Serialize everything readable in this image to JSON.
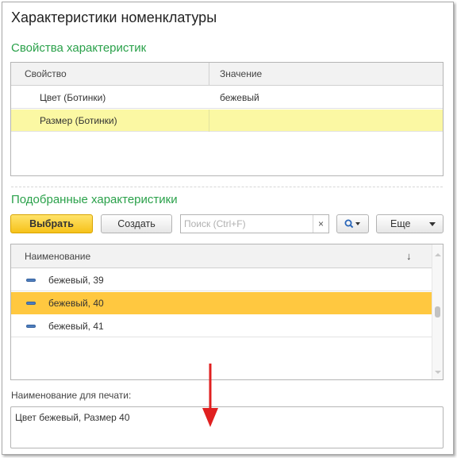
{
  "window": {
    "title": "Характеристики номенклатуры"
  },
  "properties": {
    "section_title": "Свойства характеристик",
    "columns": [
      "Свойство",
      "Значение"
    ],
    "rows": [
      {
        "property": "Цвет (Ботинки)",
        "value": "бежевый",
        "highlight": "none"
      },
      {
        "property": "Размер (Ботинки)",
        "value": "",
        "highlight": "yellow"
      }
    ]
  },
  "selected": {
    "section_title": "Подобранные характеристики",
    "toolbar": {
      "select_label": "Выбрать",
      "create_label": "Создать",
      "search_placeholder": "Поиск (Ctrl+F)",
      "clear_symbol": "×",
      "more_label": "Еще"
    },
    "column": "Наименование",
    "sort_symbol": "↓",
    "items": [
      {
        "name": "бежевый, 39",
        "selected": false
      },
      {
        "name": "бежевый, 40",
        "selected": true
      },
      {
        "name": "бежевый, 41",
        "selected": false
      }
    ]
  },
  "print_name": {
    "label": "Наименование для печати:",
    "value": "Цвет бежевый, Размер 40"
  },
  "colors": {
    "section_green": "#2aa14a",
    "highlight_yellow": "#fbf8a3",
    "selected_orange": "#ffc840",
    "arrow_red": "#e02020"
  }
}
